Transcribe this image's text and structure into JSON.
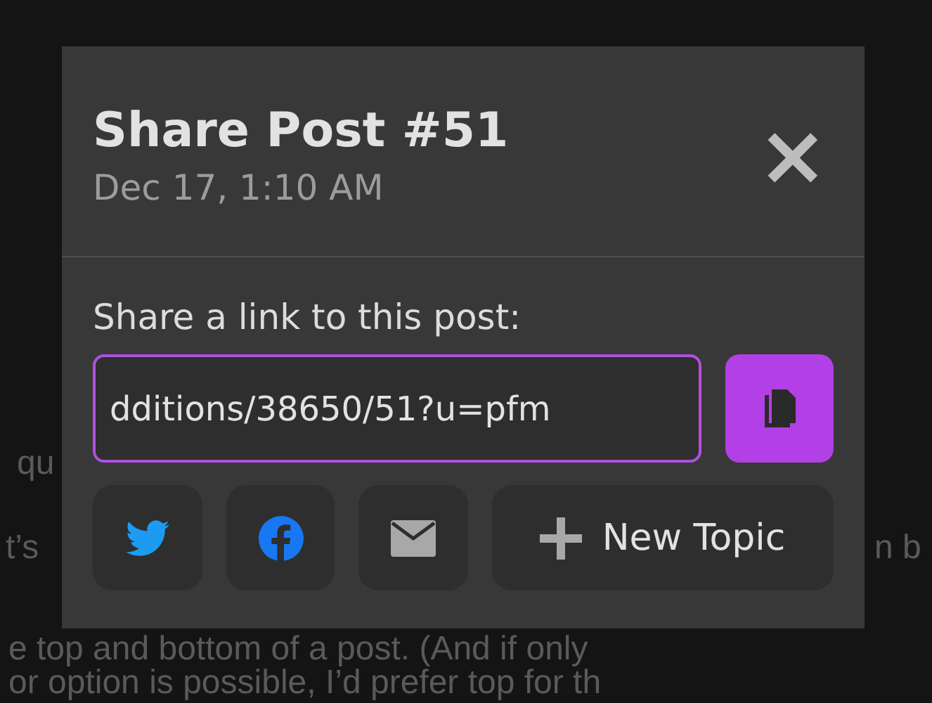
{
  "background_text": [
    "qu",
    "t’s",
    "n b",
    "e top and bottom of a post. (And if only",
    "or option is possible, I’d prefer top for th"
  ],
  "modal": {
    "title": "Share Post #51",
    "date": "Dec 17, 1:10 AM",
    "close": "×",
    "label": "Share a link to this post:",
    "link": "dditions/38650/51?u=pfm",
    "share_buttons": [
      {
        "kind": "twitter"
      },
      {
        "kind": "facebook"
      },
      {
        "kind": "email"
      }
    ],
    "new_topic": "New Topic"
  }
}
